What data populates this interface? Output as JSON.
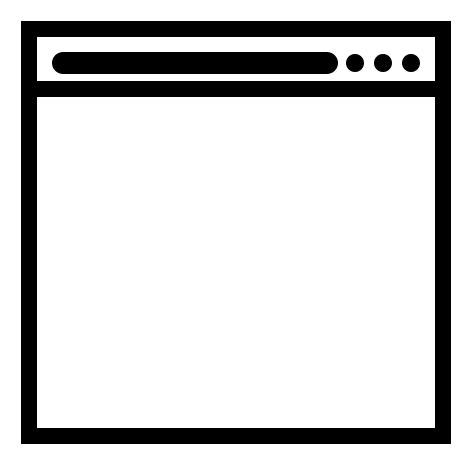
{
  "icon": {
    "name": "browser-window-icon",
    "stroke_color": "#000000",
    "fill_color": "#ffffff",
    "control_dots": 3
  }
}
